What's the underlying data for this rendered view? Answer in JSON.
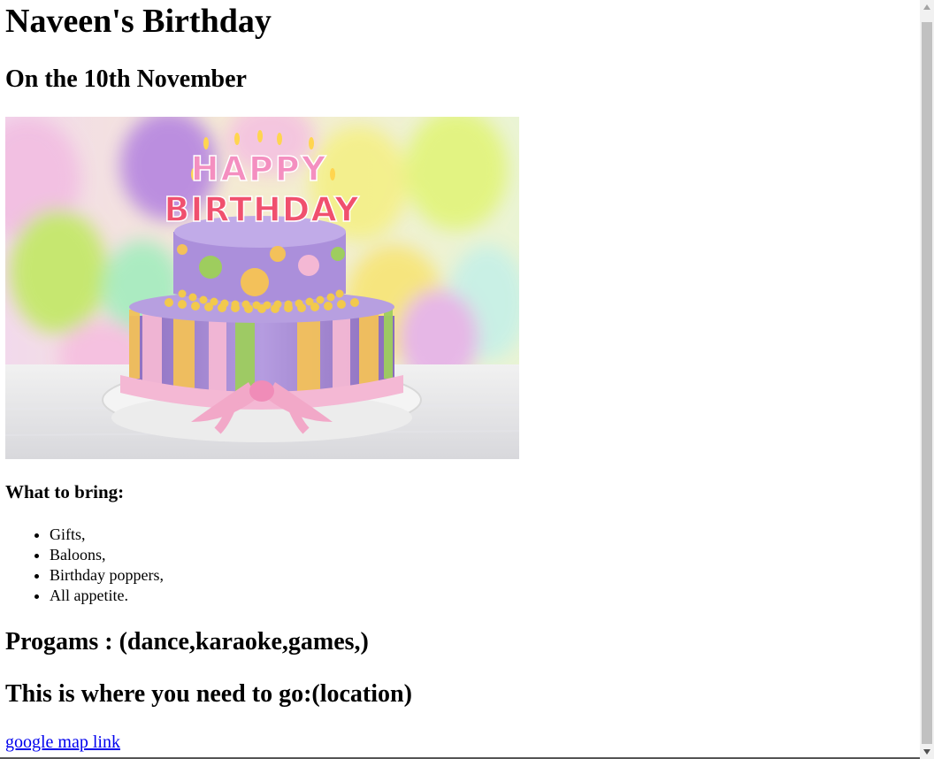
{
  "page": {
    "title": "Naveen's Birthday",
    "date_heading": "On the 10th November",
    "bring_heading": "What to bring:",
    "bring_items": [
      "Gifts,",
      "Baloons,",
      "Birthday poppers,",
      "All appetite."
    ],
    "programs_heading": "Progams : (dance,karaoke,games,)",
    "location_heading": "This is where you need to go:(location)",
    "map_link_text": "google map link"
  },
  "cake_image": {
    "topper_line1": "HAPPY",
    "topper_line2": "BIRTHDAY"
  },
  "colors": {
    "link": "#0000ee",
    "cake_purple": "#a98ad6",
    "ribbon_pink": "#f4b8d4",
    "scrollbar_thumb": "#c1c1c1"
  },
  "icons": {
    "scroll_up": "triangle-up-icon",
    "scroll_down": "triangle-down-icon"
  }
}
